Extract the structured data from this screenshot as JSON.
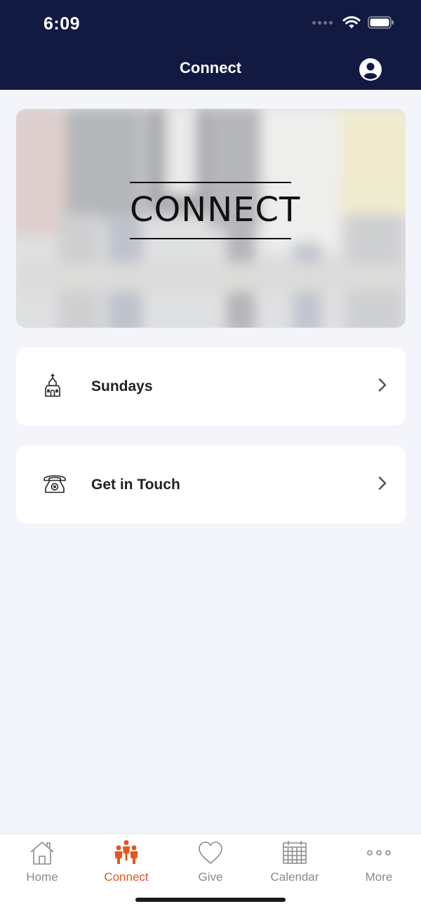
{
  "status_bar": {
    "time": "6:09"
  },
  "header": {
    "title": "Connect"
  },
  "banner": {
    "text": "CONNECT"
  },
  "list": [
    {
      "label": "Sundays",
      "icon": "church-icon"
    },
    {
      "label": "Get in Touch",
      "icon": "telephone-icon"
    }
  ],
  "tabbar": {
    "active": "Connect",
    "accent_color": "#e8541a",
    "tabs": [
      {
        "label": "Home",
        "icon": "home-icon"
      },
      {
        "label": "Connect",
        "icon": "people-icon"
      },
      {
        "label": "Give",
        "icon": "heart-icon"
      },
      {
        "label": "Calendar",
        "icon": "calendar-icon"
      },
      {
        "label": "More",
        "icon": "more-icon"
      }
    ]
  },
  "colors": {
    "header_bg": "#121a42",
    "page_bg": "#f3f5fa"
  }
}
